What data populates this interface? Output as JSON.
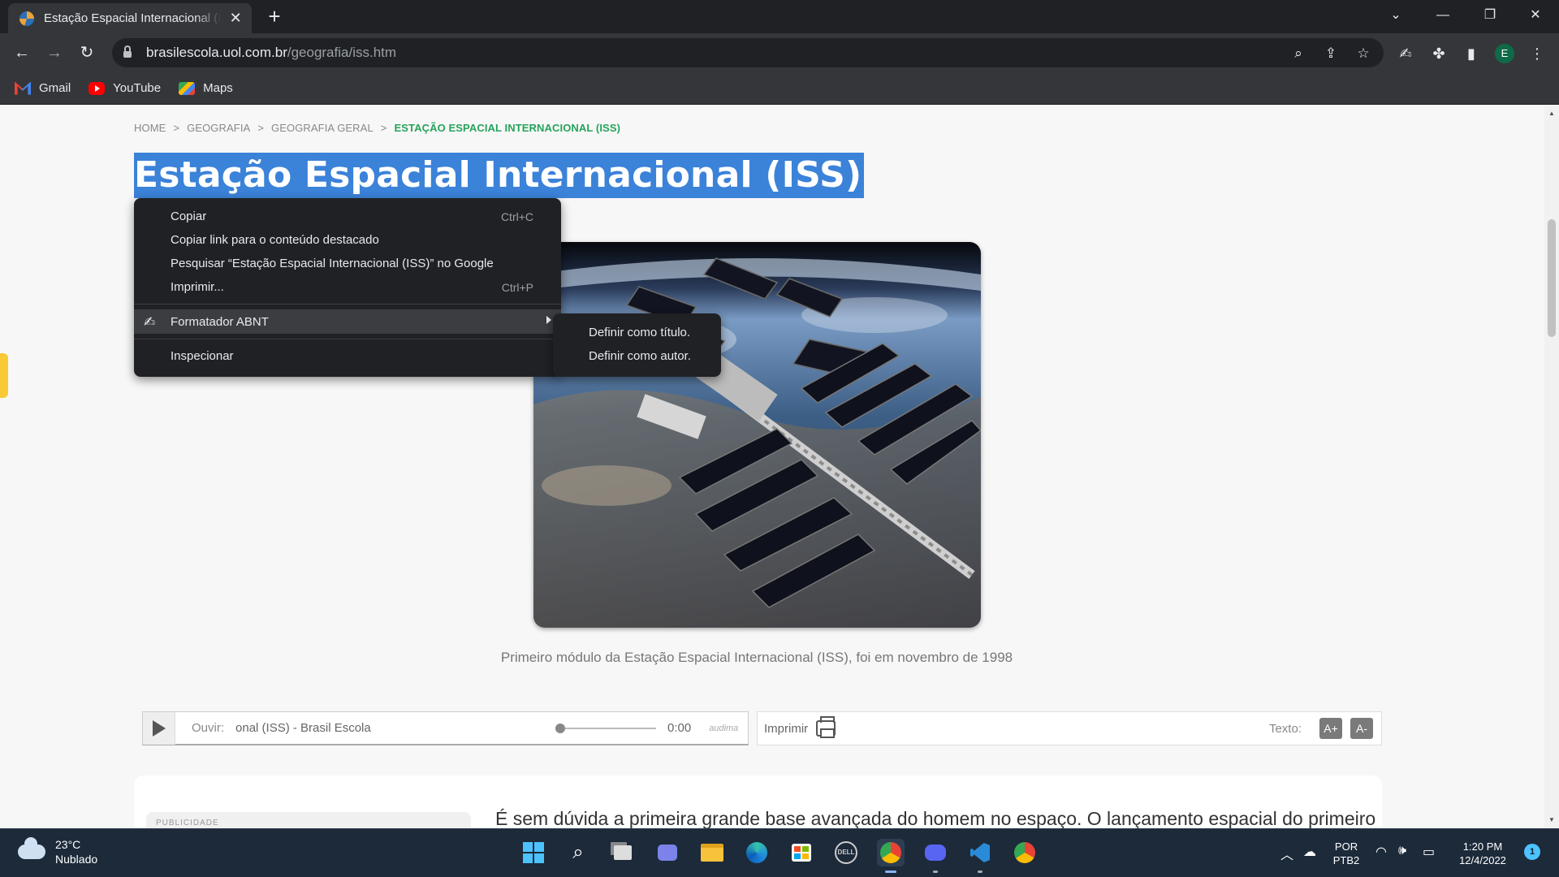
{
  "browser": {
    "tab_title": "Estação Espacial Internacional (ISS) - Brasil Escola",
    "tab_close": "✕",
    "new_tab": "+",
    "url_domain": "brasilescola.uol.com.br",
    "url_path": "/geografia/iss.htm",
    "profile_initial": "E",
    "bookmarks": [
      {
        "label": "Gmail",
        "icon": "gmail-icon"
      },
      {
        "label": "YouTube",
        "icon": "youtube-icon"
      },
      {
        "label": "Maps",
        "icon": "maps-icon"
      }
    ]
  },
  "breadcrumb": {
    "items": [
      "HOME",
      "GEOGRAFIA",
      "GEOGRAFIA GERAL"
    ],
    "current": "ESTAÇÃO ESPACIAL INTERNACIONAL (ISS)",
    "separator": ">"
  },
  "page": {
    "title": "Estação Espacial Internacional (ISS)",
    "caption": "Primeiro módulo da Estação Espacial Internacional (ISS), foi em novembro de 1998",
    "article_first_line": "É sem dúvida a primeira grande base avançada do homem no espaço. O lançamento espacial do primeiro",
    "ad_label": "PUBLICIDADE"
  },
  "audio": {
    "label": "Ouvir:",
    "title": "onal (ISS) - Brasil Escola",
    "time": "0:00",
    "brand": "audima",
    "progress": 0
  },
  "tools": {
    "print_label": "Imprimir",
    "text_label": "Texto:",
    "increase": "A+",
    "decrease": "A-"
  },
  "context_menu": {
    "items": [
      {
        "label": "Copiar",
        "shortcut": "Ctrl+C"
      },
      {
        "label": "Copiar link para o conteúdo destacado",
        "shortcut": ""
      },
      {
        "label": "Pesquisar “Estação Espacial Internacional (ISS)” no Google",
        "shortcut": ""
      },
      {
        "label": "Imprimir...",
        "shortcut": "Ctrl+P"
      }
    ],
    "extension_item": "Formatador ABNT",
    "extension_icon": "writing-hand-icon",
    "inspect": "Inspecionar",
    "submenu": [
      "Definir como título.",
      "Definir como autor."
    ]
  },
  "taskbar": {
    "temperature": "23°C",
    "weather": "Nublado",
    "language_top": "POR",
    "language_bottom": "PTB2",
    "time": "1:20 PM",
    "date": "12/4/2022",
    "notification_count": "1"
  },
  "colors": {
    "breadcrumb_current": "#27a35b",
    "title_highlight": "#3b82d9",
    "menu_bg": "#202124",
    "taskbar_bg": "#1c2a3a"
  }
}
